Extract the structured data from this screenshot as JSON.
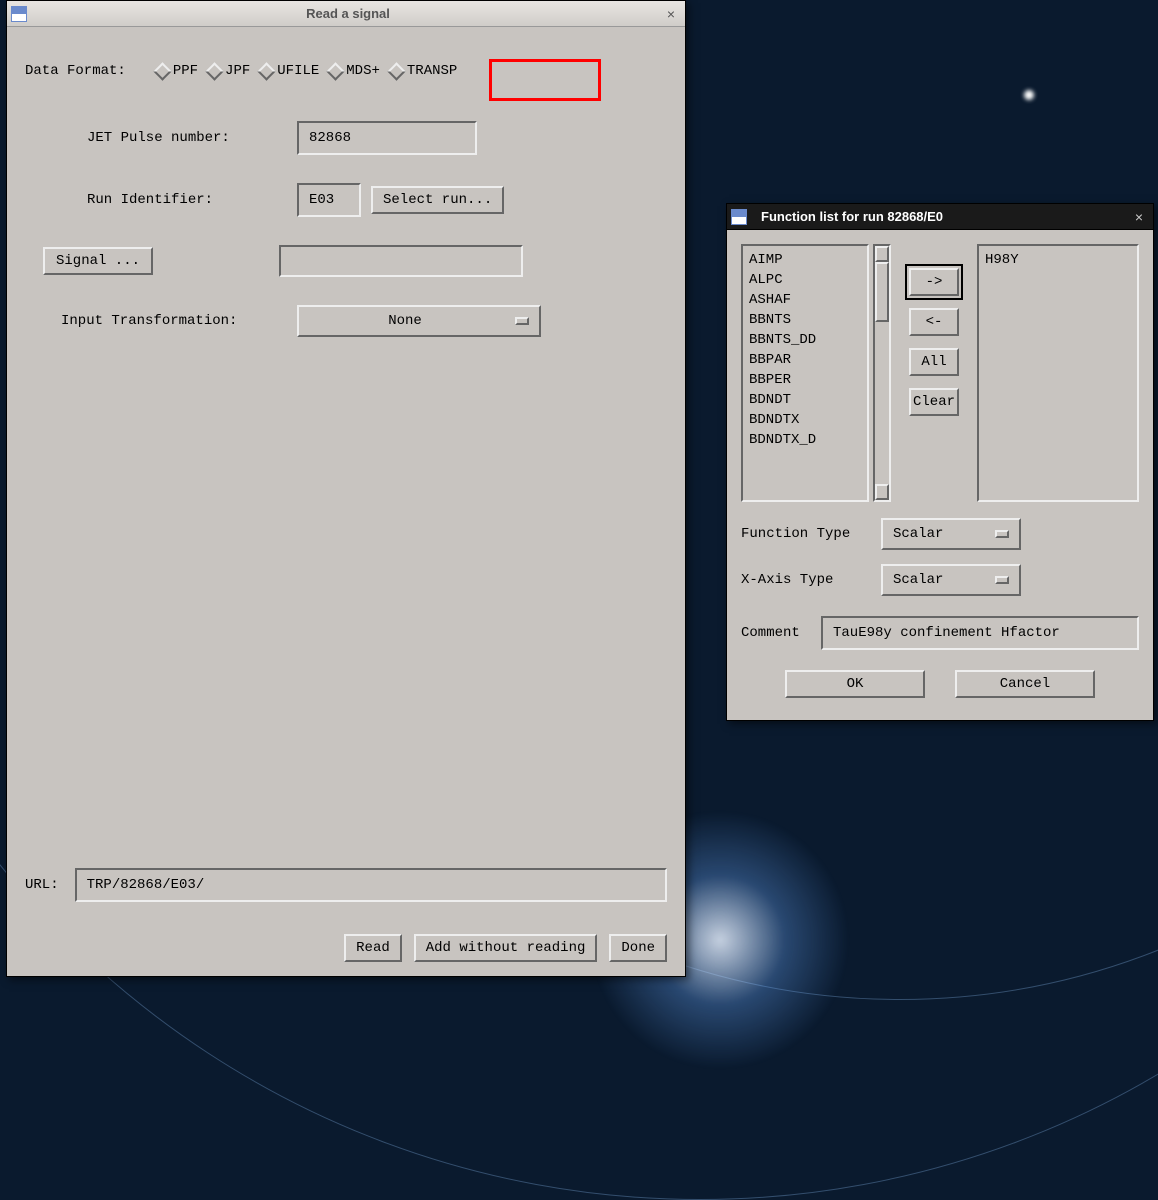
{
  "main": {
    "title": "Read a signal",
    "data_format_label": "Data Format:",
    "radios": [
      "PPF",
      "JPF",
      "UFILE",
      "MDS+",
      "TRANSP"
    ],
    "pulse_label": "JET Pulse number:",
    "pulse_value": "82868",
    "run_label": "Run Identifier:",
    "run_value": "E03",
    "select_run_btn": "Select run...",
    "signal_btn": "Signal ...",
    "signal_value": "",
    "transform_label": "Input Transformation:",
    "transform_value": "None",
    "url_label": "URL:",
    "url_value": "TRP/82868/E03/",
    "read_btn": "Read",
    "add_btn": "Add without reading",
    "done_btn": "Done"
  },
  "fn": {
    "title": "Function list for run 82868/E0",
    "available": [
      "AIMP",
      "ALPC",
      "ASHAF",
      "BBNTS",
      "BBNTS_DD",
      "BBPAR",
      "BBPER",
      "BDNDT",
      "BDNDTX",
      "BDNDTX_D"
    ],
    "selected": [
      "H98Y"
    ],
    "to_right_btn": "->",
    "to_left_btn": "<-",
    "all_btn": "All",
    "clear_btn": "Clear",
    "func_type_label": "Function Type",
    "func_type_value": "Scalar",
    "x_axis_label": "X-Axis Type",
    "x_axis_value": "Scalar",
    "comment_label": "Comment",
    "comment_value": "TauE98y confinement Hfactor",
    "ok_btn": "OK",
    "cancel_btn": "Cancel"
  }
}
